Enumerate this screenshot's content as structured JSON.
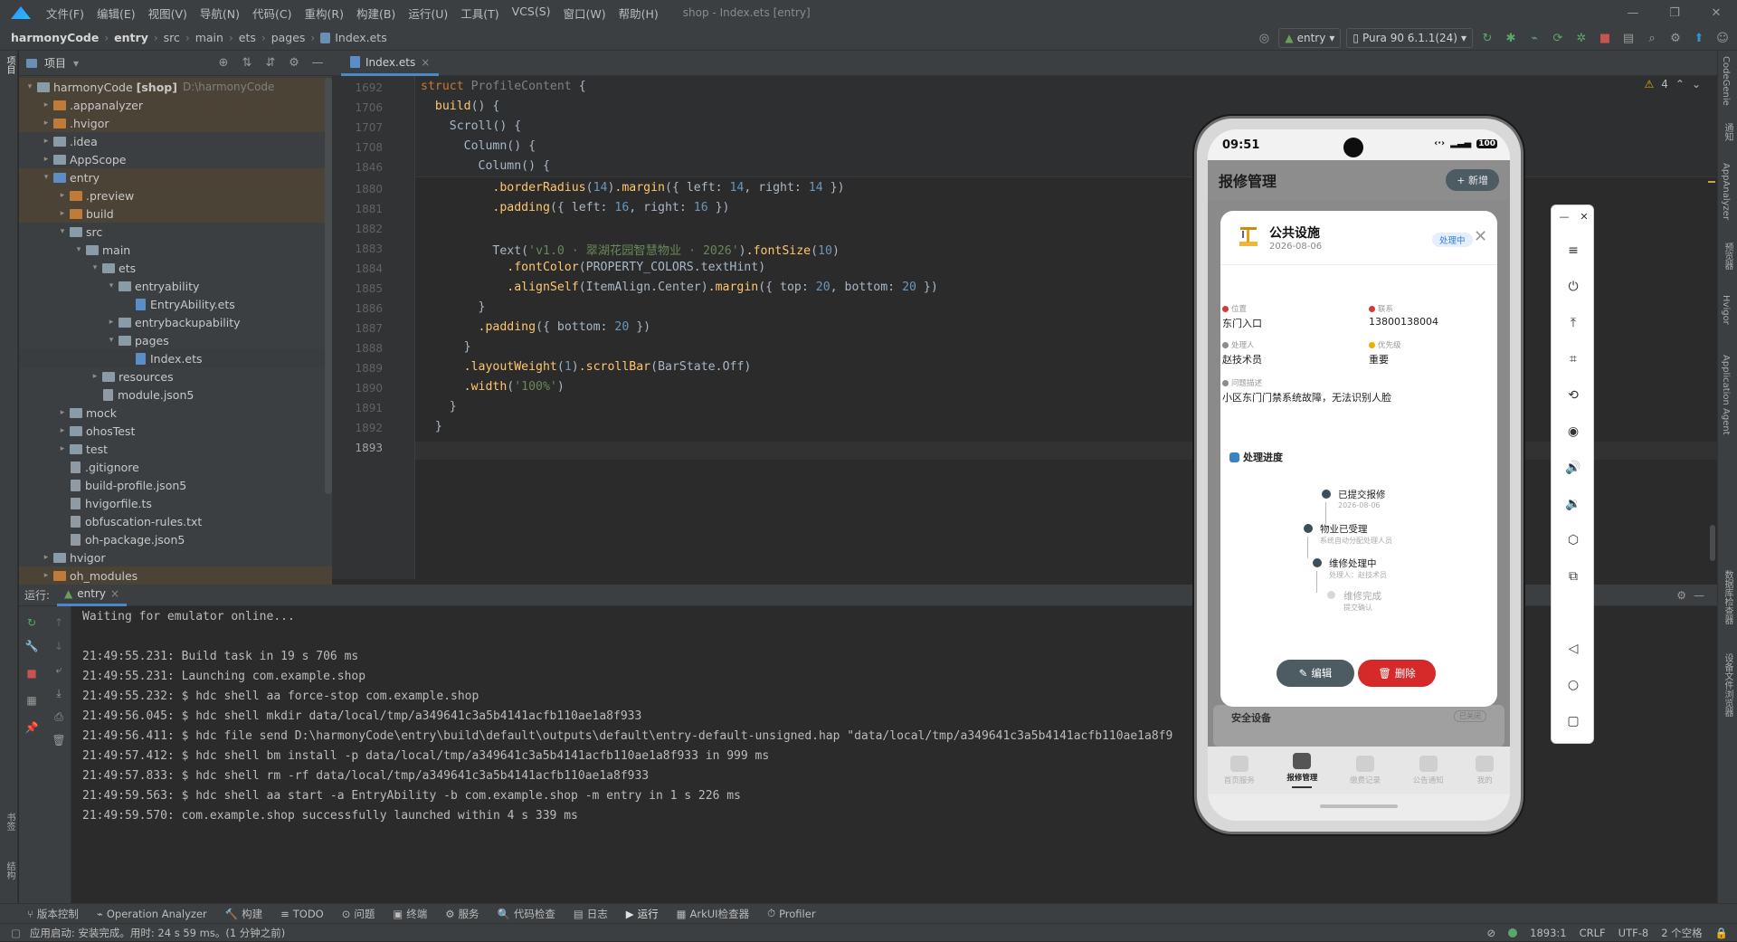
{
  "menu": {
    "items": [
      "文件(F)",
      "编辑(E)",
      "视图(V)",
      "导航(N)",
      "代码(C)",
      "重构(R)",
      "构建(B)",
      "运行(U)",
      "工具(T)",
      "VCS(S)",
      "窗口(W)",
      "帮助(H)"
    ],
    "window_title": "shop - Index.ets [entry]"
  },
  "nav": {
    "crumbs": [
      "harmonyCode",
      "entry",
      "src",
      "main",
      "ets",
      "pages",
      "Index.ets"
    ],
    "run_config": "entry",
    "device": "Pura 90 6.1.1(24)"
  },
  "project": {
    "title": "项目",
    "tree": [
      {
        "label": "harmonyCode",
        "bold": "[shop]",
        "extra": "D:\\harmonyCode",
        "depth": 0,
        "arrow": "v",
        "kind": "folder"
      },
      {
        "label": ".appanalyzer",
        "depth": 1,
        "arrow": ">",
        "kind": "folder-orange"
      },
      {
        "label": ".hvigor",
        "depth": 1,
        "arrow": ">",
        "kind": "folder-orange"
      },
      {
        "label": ".idea",
        "depth": 1,
        "arrow": ">",
        "kind": "folder"
      },
      {
        "label": "AppScope",
        "depth": 1,
        "arrow": ">",
        "kind": "folder"
      },
      {
        "label": "entry",
        "depth": 1,
        "arrow": "v",
        "kind": "folder-blue"
      },
      {
        "label": ".preview",
        "depth": 2,
        "arrow": ">",
        "kind": "folder-orange"
      },
      {
        "label": "build",
        "depth": 2,
        "arrow": ">",
        "kind": "folder-orange"
      },
      {
        "label": "src",
        "depth": 2,
        "arrow": "v",
        "kind": "folder"
      },
      {
        "label": "main",
        "depth": 3,
        "arrow": "v",
        "kind": "folder"
      },
      {
        "label": "ets",
        "depth": 4,
        "arrow": "v",
        "kind": "folder"
      },
      {
        "label": "entryability",
        "depth": 5,
        "arrow": "v",
        "kind": "folder"
      },
      {
        "label": "EntryAbility.ets",
        "depth": 6,
        "arrow": "",
        "kind": "file-ets"
      },
      {
        "label": "entrybackupability",
        "depth": 5,
        "arrow": ">",
        "kind": "folder"
      },
      {
        "label": "pages",
        "depth": 5,
        "arrow": "v",
        "kind": "folder"
      },
      {
        "label": "Index.ets",
        "depth": 6,
        "arrow": "",
        "kind": "file-ets"
      },
      {
        "label": "resources",
        "depth": 4,
        "arrow": ">",
        "kind": "folder"
      },
      {
        "label": "module.json5",
        "depth": 4,
        "arrow": "",
        "kind": "file"
      },
      {
        "label": "mock",
        "depth": 2,
        "arrow": ">",
        "kind": "folder"
      },
      {
        "label": "ohosTest",
        "depth": 2,
        "arrow": ">",
        "kind": "folder"
      },
      {
        "label": "test",
        "depth": 2,
        "arrow": ">",
        "kind": "folder"
      },
      {
        "label": ".gitignore",
        "depth": 2,
        "arrow": "",
        "kind": "file"
      },
      {
        "label": "build-profile.json5",
        "depth": 2,
        "arrow": "",
        "kind": "file"
      },
      {
        "label": "hvigorfile.ts",
        "depth": 2,
        "arrow": "",
        "kind": "file"
      },
      {
        "label": "obfuscation-rules.txt",
        "depth": 2,
        "arrow": "",
        "kind": "file"
      },
      {
        "label": "oh-package.json5",
        "depth": 2,
        "arrow": "",
        "kind": "file"
      },
      {
        "label": "hvigor",
        "depth": 1,
        "arrow": ">",
        "kind": "folder"
      },
      {
        "label": "oh_modules",
        "depth": 1,
        "arrow": ">",
        "kind": "folder-orange"
      }
    ]
  },
  "editor": {
    "tab": "Index.ets",
    "problems": "4",
    "sticky": [
      {
        "num": "1692",
        "code": "struct ProfileContent {"
      },
      {
        "num": "1706",
        "code": "  build() {"
      },
      {
        "num": "1707",
        "code": "    Scroll() {"
      },
      {
        "num": "1708",
        "code": "      Column() {"
      },
      {
        "num": "1846",
        "code": "        Column() {"
      }
    ],
    "lines": [
      {
        "num": "1880",
        "code": "          .borderRadius(14).margin({ left: 14, right: 14 })"
      },
      {
        "num": "1881",
        "code": "          .padding({ left: 16, right: 16 })"
      },
      {
        "num": "1882",
        "code": ""
      },
      {
        "num": "1883",
        "code": "          Text('v1.0 · 翠湖花园智慧物业 · 2026').fontSize(10)"
      },
      {
        "num": "1884",
        "code": "            .fontColor(PROPERTY_COLORS.textHint)"
      },
      {
        "num": "1885",
        "code": "            .alignSelf(ItemAlign.Center).margin({ top: 20, bottom: 20 })"
      },
      {
        "num": "1886",
        "code": "        }"
      },
      {
        "num": "1887",
        "code": "        .padding({ bottom: 20 })"
      },
      {
        "num": "1888",
        "code": "      }"
      },
      {
        "num": "1889",
        "code": "      .layoutWeight(1).scrollBar(BarState.Off)"
      },
      {
        "num": "1890",
        "code": "      .width('100%')"
      },
      {
        "num": "1891",
        "code": "    }"
      },
      {
        "num": "1892",
        "code": "  }"
      },
      {
        "num": "1893",
        "code": ""
      }
    ]
  },
  "run": {
    "label": "运行:",
    "tab": "entry",
    "log": [
      "Waiting for emulator online...",
      "",
      "21:49:55.231: Build task in 19 s 706 ms",
      "21:49:55.231: Launching com.example.shop",
      "21:49:55.232: $ hdc shell aa force-stop com.example.shop",
      "21:49:56.045: $ hdc shell mkdir data/local/tmp/a349641c3a5b4141acfb110ae1a8f933",
      "21:49:56.411: $ hdc file send D:\\harmonyCode\\entry\\build\\default\\outputs\\default\\entry-default-unsigned.hap \"data/local/tmp/a349641c3a5b4141acfb110ae1a8f9",
      "21:49:57.412: $ hdc shell bm install -p data/local/tmp/a349641c3a5b4141acfb110ae1a8f933 in 999 ms",
      "21:49:57.833: $ hdc shell rm -rf data/local/tmp/a349641c3a5b4141acfb110ae1a8f933",
      "21:49:59.563: $ hdc shell aa start -a EntryAbility -b com.example.shop -m entry in 1 s 226 ms",
      "21:49:59.570: com.example.shop successfully launched within 4 s 339 ms"
    ]
  },
  "bottom_tools": [
    "版本控制",
    "Operation Analyzer",
    "构建",
    "TODO",
    "问题",
    "终端",
    "服务",
    "代码检查",
    "日志",
    "运行",
    "ArkUI检查器",
    "Profiler"
  ],
  "status": {
    "message": "应用启动: 安装完成。用时: 24 s 59 ms。(1 分钟之前)",
    "position": "1893:1",
    "line_sep": "CRLF",
    "encoding": "UTF-8",
    "indent": "2 个空格"
  },
  "left_strip": [
    "项目",
    "书签",
    "结构"
  ],
  "right_strip": [
    "CodeGenie",
    "通知",
    "AppAnalyzer",
    "预览器",
    "Hvigor",
    "Application Agent",
    "数据库检查器",
    "设备文件浏览器"
  ],
  "phone": {
    "time": "09:51",
    "battery": "100",
    "app_title": "报修管理",
    "add_button": "+ 新增",
    "modal": {
      "title": "公共设施",
      "date": "2026-08-06",
      "badge": "处理中",
      "fields": [
        {
          "label": "位置",
          "value": "东门入口",
          "color": "#d33a3a"
        },
        {
          "label": "联系",
          "value": "13800138004",
          "color": "#d33a3a"
        },
        {
          "label": "处理人",
          "value": "赵技术员",
          "color": "#8a8a8a"
        },
        {
          "label": "优先级",
          "value": "重要",
          "color": "#e8b000"
        },
        {
          "label": "问题描述",
          "value": "小区东门门禁系统故障，无法识别人脸",
          "color": "#8a8a8a"
        }
      ],
      "progress_title": "处理进度",
      "steps": [
        {
          "title": "已提交报修",
          "sub": "2026-08-06"
        },
        {
          "title": "物业已受理",
          "sub": "系统自动分配处理人员"
        },
        {
          "title": "维修处理中",
          "sub": "处理人：赵技术员"
        },
        {
          "title": "维修完成",
          "sub": "提交确认"
        }
      ],
      "edit_button": "编辑",
      "delete_button": "删除"
    },
    "behind_card": {
      "title": "安全设备",
      "badge": "已关闭"
    },
    "tabs": [
      "首页服务",
      "报修管理",
      "缴费记录",
      "公告通知",
      "我的"
    ],
    "active_tab": 1
  }
}
